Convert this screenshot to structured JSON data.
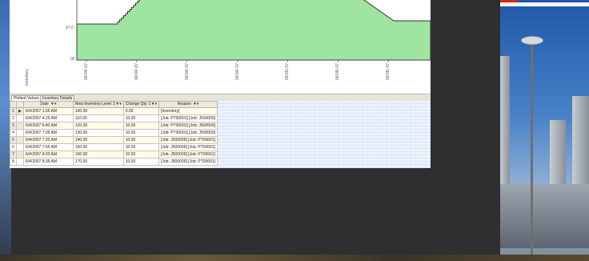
{
  "colors": {
    "chart_fill": "#9fe4a0",
    "chart_line": "#333333",
    "grid_row_even": "#fffbe6",
    "grid_header": "#ece8dc"
  },
  "chart": {
    "y_ticks": [
      "97.0",
      "00"
    ],
    "x_ticks": [
      "06/04/-07",
      "06/04/-07",
      "06/04/-07",
      "06/04/-07",
      "06/05/-07",
      "06/05/-07",
      "06/05/-07",
      "06/06/-07"
    ],
    "y_axis_title": "Inventory"
  },
  "chart_data": {
    "type": "area",
    "title": "",
    "xlabel": "",
    "ylabel": "Inventory",
    "x": [
      "06/04/-07",
      "06/04/-07",
      "06/04/-07",
      "06/04/-07",
      "06/05/-07",
      "06/05/-07",
      "06/05/-07",
      "06/06/-07"
    ],
    "series": [
      {
        "values": [
          97,
          97,
          100,
          100,
          100,
          100,
          97,
          97
        ]
      }
    ]
  },
  "tabs": [
    {
      "label": "Plotted Values",
      "active": true
    },
    {
      "label": "Inventory Details",
      "active": false
    }
  ],
  "grid": {
    "columns": [
      "",
      "Date",
      "New Inventory Level",
      "Change Qty",
      "Reason"
    ],
    "rows": [
      {
        "n": "1",
        "indicator": "▶",
        "date": "6/4/2007 1:35 AM",
        "level": "100.00",
        "change": "0.00",
        "reason": "[Inventory]"
      },
      {
        "n": "2",
        "indicator": "",
        "date": "6/4/2007 4:25 AM",
        "level": "110.00",
        "change": "10.00",
        "reason": "[Job: PT00001] [Job: J500009]"
      },
      {
        "n": "3",
        "indicator": "",
        "date": "6/4/2007 6:40 AM",
        "level": "120.00",
        "change": "10.00",
        "reason": "[Job: PT00001] [Job: J500009]"
      },
      {
        "n": "4",
        "indicator": "",
        "date": "6/4/2007 7:05 AM",
        "level": "130.00",
        "change": "10.00",
        "reason": "[Job: PT00001] [Job: J500009]"
      },
      {
        "n": "5",
        "indicator": "",
        "date": "6/4/2007 7:20 AM",
        "level": "140.00",
        "change": "10.00",
        "reason": "[Job: J500009] [Job: PT00001]"
      },
      {
        "n": "6",
        "indicator": "",
        "date": "6/4/2007 7:55 AM",
        "level": "150.00",
        "change": "10.00",
        "reason": "[Job: J500009] [Job: PT00001]"
      },
      {
        "n": "7",
        "indicator": "",
        "date": "6/4/2007 8:20 AM",
        "level": "160.00",
        "change": "10.00",
        "reason": "[Job: J500009] [Job: PT00001]"
      },
      {
        "n": "8",
        "indicator": "",
        "date": "6/4/2007 8:35 AM",
        "level": "170.00",
        "change": "10.00",
        "reason": "[Job: J500009] [Job: PT00001]"
      }
    ]
  }
}
